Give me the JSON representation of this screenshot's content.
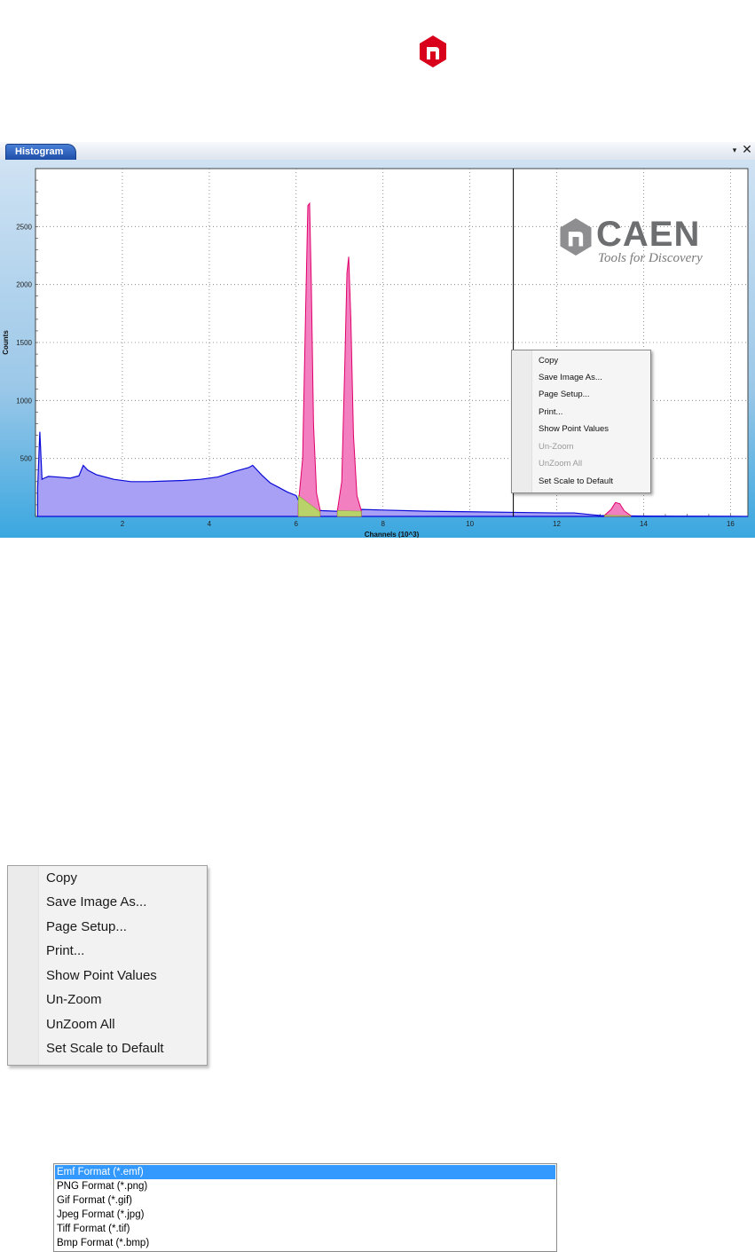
{
  "window": {
    "tab_label": "Histogram",
    "dropdown_icon": "▾",
    "close_icon": "✕"
  },
  "caen_logo": {
    "word": "CAEN",
    "tagline": "Tools for Discovery"
  },
  "context_menu_small": {
    "items": [
      {
        "label": "Copy",
        "enabled": true
      },
      {
        "label": "Save Image As...",
        "enabled": true
      },
      {
        "label": "Page Setup...",
        "enabled": true
      },
      {
        "label": "Print...",
        "enabled": true
      },
      {
        "label": "Show Point Values",
        "enabled": true
      },
      {
        "label": "Un-Zoom",
        "enabled": false
      },
      {
        "label": "UnZoom All",
        "enabled": false
      },
      {
        "label": "Set Scale to Default",
        "enabled": true
      }
    ]
  },
  "context_menu_large": {
    "items": [
      {
        "label": "Copy"
      },
      {
        "label": "Save Image As..."
      },
      {
        "label": "Page Setup..."
      },
      {
        "label": "Print..."
      },
      {
        "label": "Show Point Values"
      },
      {
        "label": "Un-Zoom"
      },
      {
        "label": "UnZoom All"
      },
      {
        "label": "Set Scale to Default"
      }
    ]
  },
  "format_list": {
    "options": [
      "Emf Format (*.emf)",
      "PNG Format (*.png)",
      "Gif Format (*.gif)",
      "Jpeg Format (*.jpg)",
      "Tiff Format (*.tif)",
      "Bmp Format (*.bmp)"
    ],
    "selected_index": 0
  },
  "colors": {
    "spectrum_line": "#0a0ad8",
    "spectrum_fill": "#a7a0f5",
    "peak_fill": "#f27fc0",
    "peak_line": "#e0006b",
    "background_fill": "#b9d36a",
    "logo_red": "#d9001b"
  },
  "chart_data": {
    "type": "area",
    "xlabel": "Channels (10^3)",
    "ylabel": "Counts",
    "xlim": [
      0,
      16.4
    ],
    "ylim": [
      0,
      3000
    ],
    "x_ticks": [
      2,
      4,
      6,
      8,
      10,
      12,
      14,
      16
    ],
    "y_ticks": [
      500,
      1000,
      1500,
      2000,
      2500
    ],
    "grid": true,
    "cursor_x": 11.0,
    "series": [
      {
        "x": [
          0.05,
          0.1,
          0.15,
          0.2,
          0.3,
          0.5,
          0.8,
          1.0,
          1.1,
          1.2,
          1.4,
          1.8,
          2.2,
          2.6,
          3.0,
          3.4,
          3.8,
          4.2,
          4.6,
          4.9,
          5.0,
          5.2,
          5.4,
          5.6,
          5.8,
          6.0,
          6.1,
          6.3,
          6.6,
          6.9,
          7.2,
          7.5,
          8.0,
          9.0,
          10.0,
          11.0,
          12.0,
          12.4,
          12.8,
          13.0,
          13.3,
          13.6,
          14.0,
          15.0,
          16.0,
          16.4
        ],
        "y": [
          250,
          730,
          320,
          330,
          345,
          340,
          330,
          350,
          440,
          400,
          360,
          320,
          300,
          300,
          305,
          310,
          320,
          340,
          390,
          420,
          440,
          360,
          290,
          250,
          210,
          180,
          100,
          60,
          50,
          45,
          45,
          60,
          55,
          45,
          40,
          35,
          30,
          30,
          15,
          8,
          5,
          5,
          3,
          2,
          1,
          0
        ]
      },
      {
        "x": [
          6.05,
          6.15,
          6.22,
          6.27,
          6.31,
          6.35,
          6.4,
          6.47,
          6.55
        ],
        "y": [
          100,
          500,
          1800,
          2680,
          2700,
          2000,
          800,
          200,
          60
        ]
      },
      {
        "x": [
          6.95,
          7.05,
          7.12,
          7.17,
          7.21,
          7.26,
          7.32,
          7.4,
          7.5
        ],
        "y": [
          50,
          300,
          1300,
          2100,
          2240,
          1700,
          700,
          180,
          50
        ]
      },
      {
        "x": [
          13.1,
          13.25,
          13.35,
          13.45,
          13.55,
          13.7
        ],
        "y": [
          10,
          60,
          120,
          110,
          50,
          8
        ]
      }
    ],
    "baselines": [
      {
        "x": [
          6.05,
          6.55
        ],
        "y": [
          180,
          40
        ]
      },
      {
        "x": [
          6.95,
          7.5
        ],
        "y": [
          50,
          45
        ]
      },
      {
        "x": [
          13.1,
          13.7
        ],
        "y": [
          10,
          5
        ]
      }
    ]
  }
}
